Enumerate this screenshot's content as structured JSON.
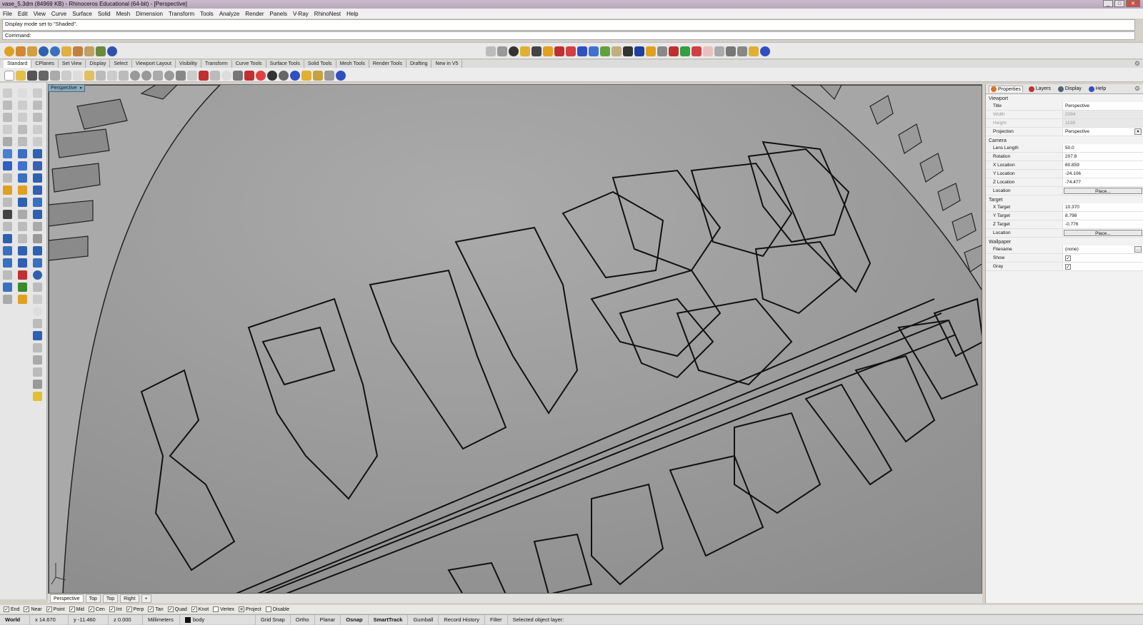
{
  "window": {
    "title": "vase_5.3dm (84969 KB) - Rhinoceros Educational (64-bit) - [Perspective]",
    "min": "_",
    "max": "□",
    "close": "✕"
  },
  "menu": [
    "File",
    "Edit",
    "View",
    "Curve",
    "Surface",
    "Solid",
    "Mesh",
    "Dimension",
    "Transform",
    "Tools",
    "Analyze",
    "Render",
    "Panels",
    "V-Ray",
    "RhinoNest",
    "Help"
  ],
  "command_history": "Display mode set to \"Shaded\".",
  "command_prompt": "Command:",
  "toolbar_tabs": [
    "Standard",
    "CPlanes",
    "Set View",
    "Display",
    "Select",
    "Viewport Layout",
    "Visibility",
    "Transform",
    "Curve Tools",
    "Surface Tools",
    "Solid Tools",
    "Mesh Tools",
    "Render Tools",
    "Drafting",
    "New in V5"
  ],
  "viewport": {
    "label": "Perspective",
    "dropdown": "▾",
    "bottom_tabs": [
      "Perspective",
      "Top",
      "Top",
      "Right"
    ],
    "add_tab": "+"
  },
  "panel": {
    "tabs": [
      {
        "label": "Properties",
        "color": "#e07020"
      },
      {
        "label": "Layers",
        "color": "#c03030"
      },
      {
        "label": "Display",
        "color": "#506070"
      },
      {
        "label": "Help",
        "color": "#3050c0"
      }
    ],
    "viewport_section": "Viewport",
    "title_label": "Title",
    "title_value": "Perspective",
    "width_label": "Width",
    "width_value": "2094",
    "height_label": "Height",
    "height_value": "1138",
    "projection_label": "Projection",
    "projection_value": "Perspective",
    "camera_section": "Camera",
    "lens_label": "Lens Length",
    "lens_value": "50.0",
    "rotation_label": "Rotation",
    "rotation_value": "207.8",
    "xloc_label": "X Location",
    "xloc_value": "60.859",
    "yloc_label": "Y Location",
    "yloc_value": "-24.106",
    "zloc_label": "Z Location",
    "zloc_value": "-74.477",
    "location_label": "Location",
    "place_label": "Place...",
    "target_section": "Target",
    "xt_label": "X Target",
    "xt_value": "10.370",
    "yt_label": "Y Target",
    "yt_value": "8.798",
    "zt_label": "Z Target",
    "zt_value": "-0.776",
    "tloc_label": "Location",
    "tplace_label": "Place...",
    "wallpaper_section": "Wallpaper",
    "filename_label": "Filename",
    "filename_value": "(none)",
    "show_label": "Show",
    "show_checked": "✓",
    "gray_label": "Gray",
    "gray_checked": "✓"
  },
  "osnaps": [
    {
      "label": "End",
      "checked": "✓"
    },
    {
      "label": "Near",
      "checked": "✓"
    },
    {
      "label": "Point",
      "checked": "✓"
    },
    {
      "label": "Mid",
      "checked": "✓"
    },
    {
      "label": "Cen",
      "checked": "✓"
    },
    {
      "label": "Int",
      "checked": "✓"
    },
    {
      "label": "Perp",
      "checked": "✓"
    },
    {
      "label": "Tan",
      "checked": "✓"
    },
    {
      "label": "Quad",
      "checked": "✓"
    },
    {
      "label": "Knot",
      "checked": "✓"
    },
    {
      "label": "Vertex",
      "checked": ""
    },
    {
      "label": "Project",
      "checked": "■"
    },
    {
      "label": "Disable",
      "checked": ""
    }
  ],
  "status": {
    "cplane": "World",
    "x": "x 14.670",
    "y": "y -11.460",
    "z": "z 0.000",
    "units": "Millimeters",
    "layer": "body",
    "grid_snap": "Grid Snap",
    "ortho": "Ortho",
    "planar": "Planar",
    "osnap": "Osnap",
    "smarttrack": "SmartTrack",
    "gumball": "Gumball",
    "record_history": "Record History",
    "filter": "Filter",
    "message": "Selected object layer:"
  }
}
